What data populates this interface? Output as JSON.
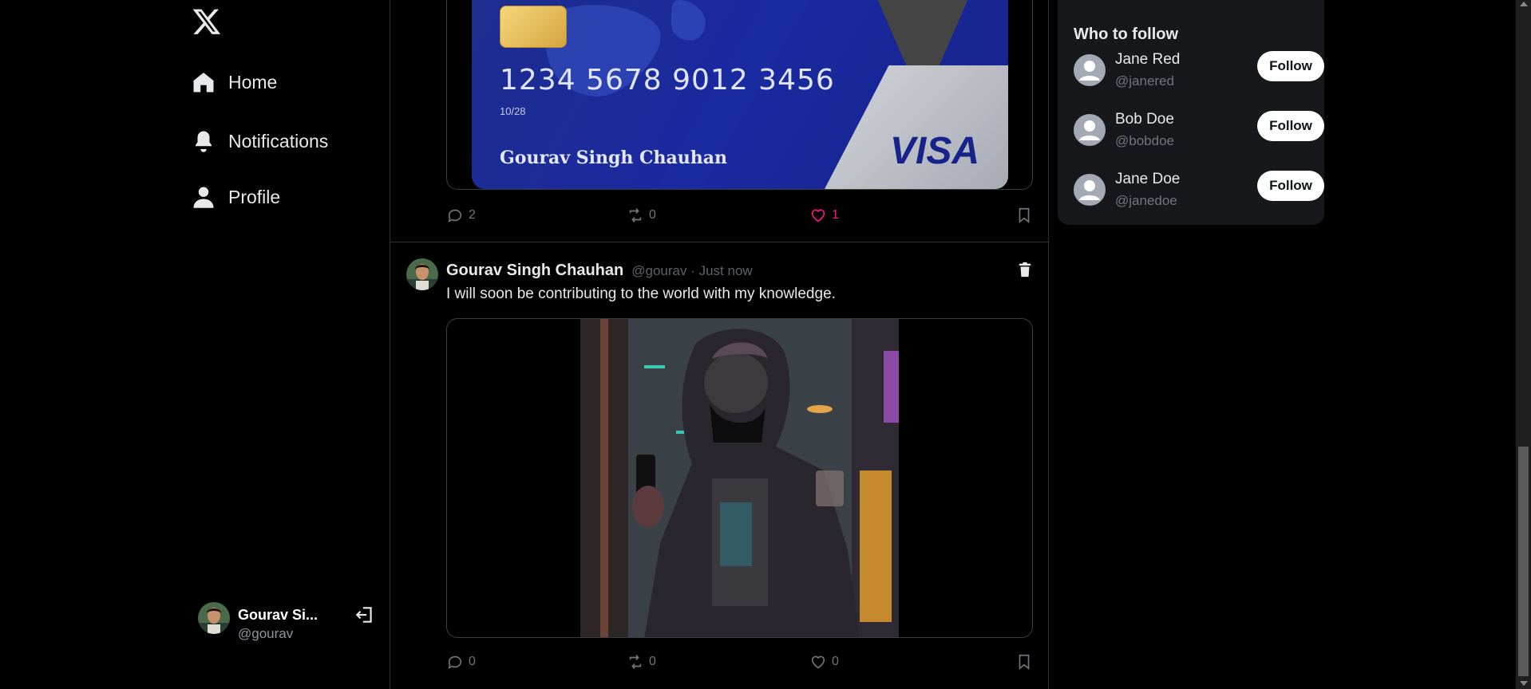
{
  "sidebar": {
    "logo_icon": "x-logo-icon",
    "nav": [
      {
        "label": "Home",
        "icon": "home-icon"
      },
      {
        "label": "Notifications",
        "icon": "bell-icon"
      },
      {
        "label": "Profile",
        "icon": "user-icon"
      }
    ],
    "account": {
      "name": "Gourav Si...",
      "handle": "@gourav",
      "logout_icon": "logout-icon"
    }
  },
  "feed": {
    "post1": {
      "card": {
        "number": "1234 5678 9012 3456",
        "expiry": "10/28",
        "holder": "Gourav Singh Chauhan",
        "brand": "VISA"
      },
      "replies": "2",
      "retweets": "0",
      "likes": "1",
      "liked": true
    },
    "post2": {
      "author": "Gourav Singh Chauhan",
      "meta": "@gourav · Just now",
      "text": "I will soon be contributing to the world with my knowledge.",
      "replies": "0",
      "retweets": "0",
      "likes": "0"
    }
  },
  "who_to_follow": {
    "title": "Who to follow",
    "users": [
      {
        "name": "Jane Red",
        "handle": "@janered",
        "button": "Follow"
      },
      {
        "name": "Bob Doe",
        "handle": "@bobdoe",
        "button": "Follow"
      },
      {
        "name": "Jane Doe",
        "handle": "@janedoe",
        "button": "Follow"
      }
    ]
  },
  "colors": {
    "like": "#f91880",
    "background": "#000000",
    "panel": "#16181c",
    "border": "#2f3336"
  }
}
